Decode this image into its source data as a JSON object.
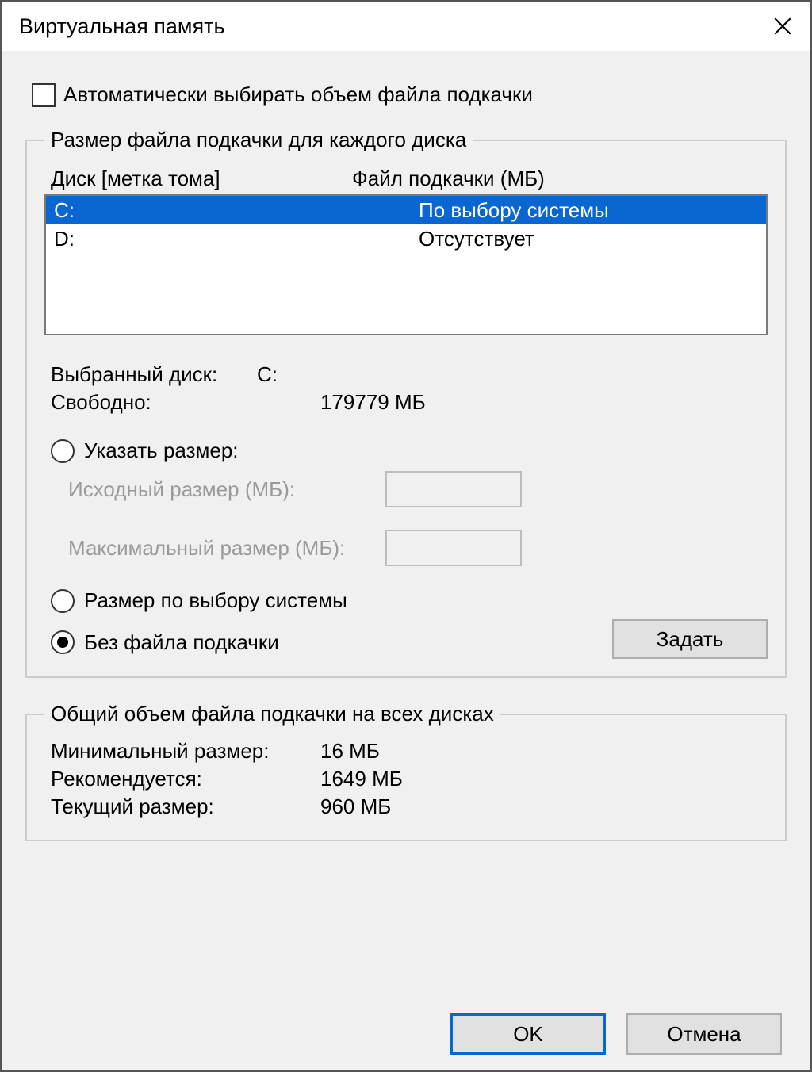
{
  "title": "Виртуальная память",
  "auto_checkbox_label": "Автоматически выбирать объем файла подкачки",
  "group1": {
    "legend": "Размер файла подкачки для каждого диска",
    "header_drive": "Диск [метка тома]",
    "header_pagefile": "Файл подкачки (МБ)",
    "drives": [
      {
        "drive": "C:",
        "value": "По выбору системы",
        "selected": true
      },
      {
        "drive": "D:",
        "value": "Отсутствует",
        "selected": false
      }
    ],
    "selected_drive_label": "Выбранный диск:",
    "selected_drive_value": "C:",
    "free_label": "Свободно:",
    "free_value": "179779 МБ",
    "radio_custom": "Указать размер:",
    "initial_size_label": "Исходный размер (МБ):",
    "max_size_label": "Максимальный размер (МБ):",
    "radio_system": "Размер по выбору системы",
    "radio_none": "Без файла подкачки",
    "set_button": "Задать"
  },
  "group2": {
    "legend": "Общий объем файла подкачки на всех дисках",
    "min_label": "Минимальный размер:",
    "min_value": "16 МБ",
    "rec_label": "Рекомендуется:",
    "rec_value": "1649 МБ",
    "cur_label": "Текущий размер:",
    "cur_value": "960 МБ"
  },
  "buttons": {
    "ok": "OK",
    "cancel": "Отмена"
  }
}
